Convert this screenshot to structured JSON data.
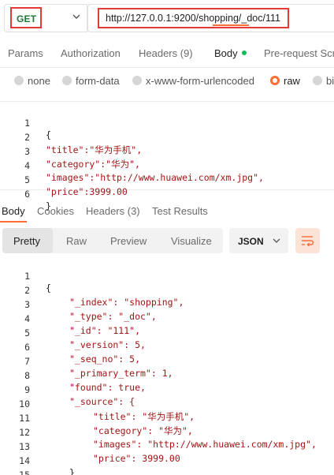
{
  "request": {
    "method": "GET",
    "url": "http://127.0.0.1:9200/shopping/_doc/111"
  },
  "request_tabs": [
    "Params",
    "Authorization",
    "Headers (9)",
    "Body",
    "Pre-request Scr"
  ],
  "body_types": [
    "none",
    "form-data",
    "x-www-form-urlencoded",
    "raw",
    "bi"
  ],
  "request_body_lines": [
    "{",
    "\"title\":\"华为手机\",",
    "\"category\":\"华为\",",
    "\"images\":\"http://www.huawei.com/xm.jpg\",",
    "\"price\":3999.00",
    "}"
  ],
  "response_tabs": [
    "Body",
    "Cookies",
    "Headers (3)",
    "Test Results"
  ],
  "view_modes": [
    "Pretty",
    "Raw",
    "Preview",
    "Visualize"
  ],
  "format": "JSON",
  "response_body_lines": [
    "{",
    "\"_index\": \"shopping\",",
    "\"_type\": \"_doc\",",
    "\"_id\": \"111\",",
    "\"_version\": 5,",
    "\"_seq_no\": 5,",
    "\"_primary_term\": 1,",
    "\"found\": true,",
    "\"_source\": {",
    "\"title\": \"华为手机\",",
    "\"category\": \"华为\",",
    "\"images\": \"http://www.huawei.com/xm.jpg\",",
    "\"price\": 3999.00",
    "}",
    "}"
  ],
  "colors": {
    "accent": "#ff6c37",
    "highlight": "#e53935",
    "get_method": "#1a7a35",
    "active_dot": "#0cbb52"
  }
}
